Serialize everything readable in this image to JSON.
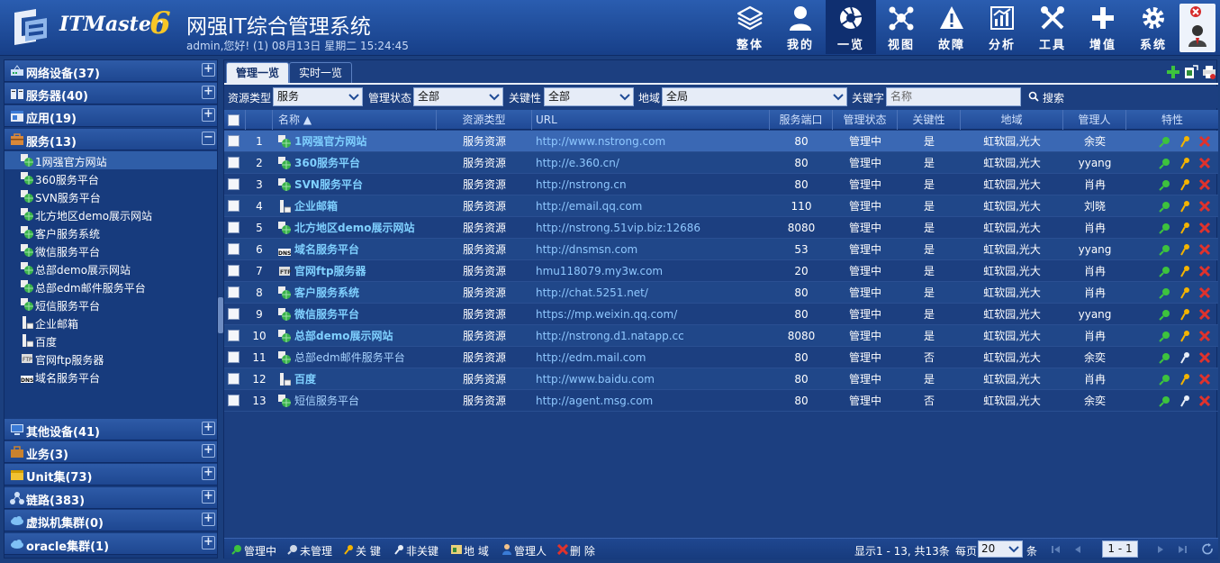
{
  "header": {
    "brand": "ITMaster",
    "brand_version": "6",
    "title": "网强IT综合管理系统",
    "user_info": "admin,您好! (1) 08月13日 星期二 15:24:45"
  },
  "nav": [
    {
      "label": "整体",
      "icon": "layers-icon"
    },
    {
      "label": "我的",
      "icon": "user-icon"
    },
    {
      "label": "一览",
      "icon": "aperture-icon",
      "active": true
    },
    {
      "label": "视图",
      "icon": "topology-icon"
    },
    {
      "label": "故障",
      "icon": "warning-icon"
    },
    {
      "label": "分析",
      "icon": "chart-icon"
    },
    {
      "label": "工具",
      "icon": "tools-icon"
    },
    {
      "label": "增值",
      "icon": "plus-icon"
    },
    {
      "label": "系统",
      "icon": "gear-icon"
    }
  ],
  "sidebar": {
    "groups_top": [
      {
        "label": "网络设备(37)",
        "icon": "network-device-icon",
        "toggle": "+"
      },
      {
        "label": "服务器(40)",
        "icon": "server-icon",
        "toggle": "+"
      },
      {
        "label": "应用(19)",
        "icon": "application-icon",
        "toggle": "+"
      },
      {
        "label": "服务(13)",
        "icon": "service-icon",
        "toggle": "−"
      }
    ],
    "service_items": [
      {
        "label": "1网强官方网站",
        "icon": "globe-icon",
        "selected": true
      },
      {
        "label": "360服务平台",
        "icon": "globe-icon"
      },
      {
        "label": "SVN服务平台",
        "icon": "globe-icon"
      },
      {
        "label": "北方地区demo展示网站",
        "icon": "globe-icon"
      },
      {
        "label": "客户服务系统",
        "icon": "globe-icon"
      },
      {
        "label": "微信服务平台",
        "icon": "globe-icon"
      },
      {
        "label": "总部demo展示网站",
        "icon": "globe-icon"
      },
      {
        "label": "总部edm邮件服务平台",
        "icon": "globe-icon"
      },
      {
        "label": "短信服务平台",
        "icon": "globe-icon"
      },
      {
        "label": "企业邮箱",
        "icon": "mail-server-icon"
      },
      {
        "label": "百度",
        "icon": "mail-server-icon"
      },
      {
        "label": "官网ftp服务器",
        "icon": "ftp-icon"
      },
      {
        "label": "域名服务平台",
        "icon": "dns-icon"
      }
    ],
    "groups_bottom": [
      {
        "label": "其他设备(41)",
        "icon": "monitor-icon",
        "toggle": "+"
      },
      {
        "label": "业务(3)",
        "icon": "business-icon",
        "toggle": "+"
      },
      {
        "label": "Unit集(73)",
        "icon": "unit-icon",
        "toggle": "+"
      },
      {
        "label": "链路(383)",
        "icon": "link-icon",
        "toggle": "+"
      },
      {
        "label": "虚拟机集群(0)",
        "icon": "cloud-icon",
        "toggle": "+"
      },
      {
        "label": "oracle集群(1)",
        "icon": "cloud-icon",
        "toggle": "+"
      }
    ]
  },
  "tabs": [
    {
      "label": "管理一览"
    },
    {
      "label": "实时一览"
    }
  ],
  "filter": {
    "resource_type_label": "资源类型",
    "resource_type_value": "服务",
    "manage_state_label": "管理状态",
    "manage_state_value": "全部",
    "critical_label": "关键性",
    "critical_value": "全部",
    "region_label": "地域",
    "region_value": "全局",
    "keyword_label": "关键字",
    "keyword_placeholder": "名称",
    "search_label": "搜索"
  },
  "table": {
    "columns": [
      "名称 ▲",
      "资源类型",
      "URL",
      "服务端口",
      "管理状态",
      "关键性",
      "地域",
      "管理人",
      "特性"
    ],
    "rows": [
      {
        "no": "1",
        "name": "1网强官方网站",
        "type": "服务资源",
        "url": "http://www.nstrong.com",
        "port": "80",
        "state": "管理中",
        "critical": "是",
        "region": "虹软园,光大",
        "owner": "余奕",
        "icon": "globe-icon"
      },
      {
        "no": "2",
        "name": "360服务平台",
        "type": "服务资源",
        "url": "http://e.360.cn/",
        "port": "80",
        "state": "管理中",
        "critical": "是",
        "region": "虹软园,光大",
        "owner": "yyang",
        "icon": "globe-icon"
      },
      {
        "no": "3",
        "name": "SVN服务平台",
        "type": "服务资源",
        "url": "http://nstrong.cn",
        "port": "80",
        "state": "管理中",
        "critical": "是",
        "region": "虹软园,光大",
        "owner": "肖冉",
        "icon": "globe-icon"
      },
      {
        "no": "4",
        "name": "企业邮箱",
        "type": "服务资源",
        "url": "http://email.qq.com",
        "port": "110",
        "state": "管理中",
        "critical": "是",
        "region": "虹软园,光大",
        "owner": "刘晓",
        "icon": "mail-server-icon"
      },
      {
        "no": "5",
        "name": "北方地区demo展示网站",
        "type": "服务资源",
        "url": "http://nstrong.51vip.biz:12686",
        "port": "8080",
        "state": "管理中",
        "critical": "是",
        "region": "虹软园,光大",
        "owner": "肖冉",
        "icon": "globe-icon"
      },
      {
        "no": "6",
        "name": "域名服务平台",
        "type": "服务资源",
        "url": "http://dnsmsn.com",
        "port": "53",
        "state": "管理中",
        "critical": "是",
        "region": "虹软园,光大",
        "owner": "yyang",
        "icon": "dns-icon"
      },
      {
        "no": "7",
        "name": "官网ftp服务器",
        "type": "服务资源",
        "url": "hmu118079.my3w.com",
        "port": "20",
        "state": "管理中",
        "critical": "是",
        "region": "虹软园,光大",
        "owner": "肖冉",
        "icon": "ftp-icon"
      },
      {
        "no": "8",
        "name": "客户服务系统",
        "type": "服务资源",
        "url": "http://chat.5251.net/",
        "port": "80",
        "state": "管理中",
        "critical": "是",
        "region": "虹软园,光大",
        "owner": "肖冉",
        "icon": "globe-icon"
      },
      {
        "no": "9",
        "name": "微信服务平台",
        "type": "服务资源",
        "url": "https://mp.weixin.qq.com/",
        "port": "80",
        "state": "管理中",
        "critical": "是",
        "region": "虹软园,光大",
        "owner": "yyang",
        "icon": "globe-icon"
      },
      {
        "no": "10",
        "name": "总部demo展示网站",
        "type": "服务资源",
        "url": "http://nstrong.d1.natapp.cc",
        "port": "8080",
        "state": "管理中",
        "critical": "是",
        "region": "虹软园,光大",
        "owner": "肖冉",
        "icon": "globe-icon"
      },
      {
        "no": "11",
        "name": "总部edm邮件服务平台",
        "type": "服务资源",
        "url": "http://edm.mail.com",
        "port": "80",
        "state": "管理中",
        "critical": "否",
        "region": "虹软园,光大",
        "owner": "余奕",
        "icon": "globe-icon"
      },
      {
        "no": "12",
        "name": "百度",
        "type": "服务资源",
        "url": "http://www.baidu.com",
        "port": "80",
        "state": "管理中",
        "critical": "是",
        "region": "虹软园,光大",
        "owner": "肖冉",
        "icon": "mail-server-icon"
      },
      {
        "no": "13",
        "name": "短信服务平台",
        "type": "服务资源",
        "url": "http://agent.msg.com",
        "port": "80",
        "state": "管理中",
        "critical": "否",
        "region": "虹软园,光大",
        "owner": "余奕",
        "icon": "globe-icon"
      }
    ]
  },
  "footer": {
    "actions": [
      {
        "label": "管理中",
        "icon": "manage-icon"
      },
      {
        "label": "未管理",
        "icon": "unmanage-icon"
      },
      {
        "label": "关 键",
        "icon": "key-icon"
      },
      {
        "label": "非关键",
        "icon": "key-off-icon"
      },
      {
        "label": "地 域",
        "icon": "region-icon"
      },
      {
        "label": "管理人",
        "icon": "admin-user-icon"
      },
      {
        "label": "删 除",
        "icon": "delete-icon"
      }
    ],
    "range_text": "显示1 - 13, 共13条",
    "per_page_label": "每页",
    "per_page_value": "20",
    "per_page_unit": "条",
    "page_value": "1 - 1"
  },
  "colors": {
    "accent": "#1b3f7e",
    "header_top": "#2a5db0",
    "highlight_row": "#3a68b4",
    "link_blue": "#7fd0ff",
    "delete_red": "#e0322c",
    "key_gold": "#f4b400",
    "manage_green": "#3dc33d"
  }
}
